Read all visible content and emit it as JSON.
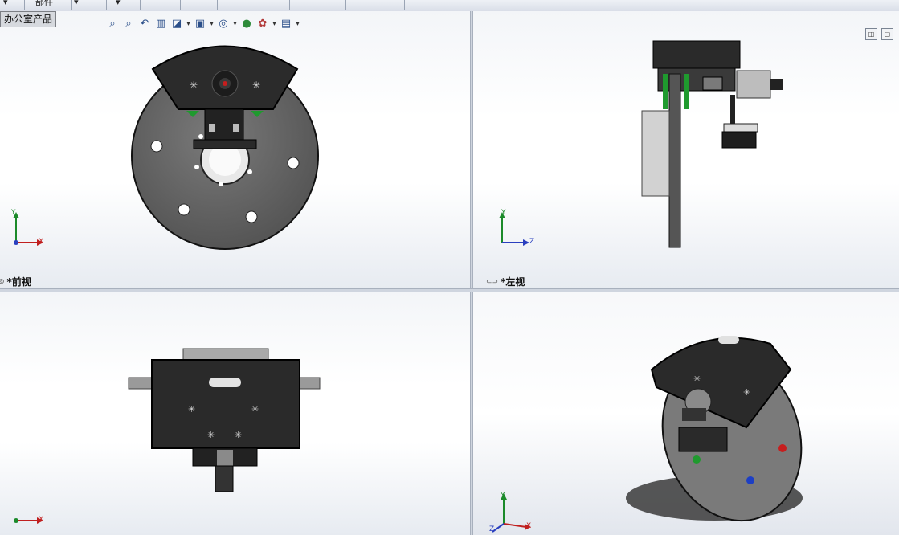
{
  "top_tabs": [
    "",
    "部件",
    "",
    "",
    "",
    "",
    "",
    "",
    "",
    ""
  ],
  "tooltip": "办公室产品",
  "hud_icons": [
    "zoom-to-fit-icon",
    "zoom-area-icon",
    "previous-view-icon",
    "section-view-icon",
    "view-orientation-icon",
    "display-style-icon",
    "hide-show-icon",
    "edit-appearance-icon",
    "apply-scene-icon",
    "view-settings-icon"
  ],
  "viewports": {
    "front": {
      "label": "*前视",
      "axes": {
        "up": "Y",
        "right": "X"
      }
    },
    "left": {
      "label": "*左视",
      "axes": {
        "up": "Y",
        "right": "Z"
      }
    },
    "top": {
      "axes": {
        "right": "X"
      }
    },
    "iso": {
      "axes": {
        "up": "Y",
        "right": "X",
        "diag": "Z"
      }
    }
  },
  "viewport_controls": [
    "split-icon",
    "maximize-icon"
  ],
  "colors": {
    "disk": "#6b6b6b",
    "housing": "#2a2a2a",
    "marker_red": "#c61e1e",
    "marker_green": "#1f9a2e",
    "marker_blue": "#1d3fc4",
    "axis_y": "#1b8a2a",
    "axis_x": "#c01f1f",
    "axis_z": "#2a3fbf"
  }
}
